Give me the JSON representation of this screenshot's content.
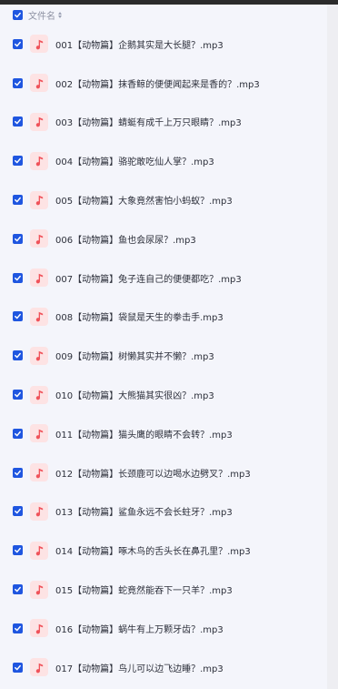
{
  "header": {
    "column_label": "文件名",
    "checked": true
  },
  "colors": {
    "checkbox": "#1f56e0",
    "music_icon": "#f0525a",
    "music_icon_bg": "#fde3e4"
  },
  "files": [
    {
      "name": "001【动物篇】企鹅其实是大长腿？.mp3",
      "checked": true,
      "icon": "music-note-icon"
    },
    {
      "name": "002【动物篇】抹香鲸的便便闻起来是香的？.mp3",
      "checked": true,
      "icon": "music-note-icon"
    },
    {
      "name": "003【动物篇】蜻蜓有成千上万只眼睛？.mp3",
      "checked": true,
      "icon": "music-note-icon"
    },
    {
      "name": "004【动物篇】骆驼敢吃仙人掌？.mp3",
      "checked": true,
      "icon": "music-note-icon"
    },
    {
      "name": "005【动物篇】大象竟然害怕小蚂蚁？.mp3",
      "checked": true,
      "icon": "music-note-icon"
    },
    {
      "name": "006【动物篇】鱼也会尿尿？.mp3",
      "checked": true,
      "icon": "music-note-icon"
    },
    {
      "name": "007【动物篇】兔子连自己的便便都吃？.mp3",
      "checked": true,
      "icon": "music-note-icon"
    },
    {
      "name": "008【动物篇】袋鼠是天生的拳击手.mp3",
      "checked": true,
      "icon": "music-note-icon"
    },
    {
      "name": "009【动物篇】树懒其实并不懒？.mp3",
      "checked": true,
      "icon": "music-note-icon"
    },
    {
      "name": "010【动物篇】大熊猫其实很凶？.mp3",
      "checked": true,
      "icon": "music-note-icon"
    },
    {
      "name": "011【动物篇】猫头鹰的眼睛不会转？.mp3",
      "checked": true,
      "icon": "music-note-icon"
    },
    {
      "name": "012【动物篇】长颈鹿可以边喝水边劈叉？.mp3",
      "checked": true,
      "icon": "music-note-icon"
    },
    {
      "name": "013【动物篇】鲨鱼永远不会长蛀牙？.mp3",
      "checked": true,
      "icon": "music-note-icon"
    },
    {
      "name": "014【动物篇】啄木鸟的舌头长在鼻孔里？.mp3",
      "checked": true,
      "icon": "music-note-icon"
    },
    {
      "name": "015【动物篇】蛇竟然能吞下一只羊？.mp3",
      "checked": true,
      "icon": "music-note-icon"
    },
    {
      "name": "016【动物篇】蜗牛有上万颗牙齿？.mp3",
      "checked": true,
      "icon": "music-note-icon"
    },
    {
      "name": "017【动物篇】鸟儿可以边飞边睡？.mp3",
      "checked": true,
      "icon": "music-note-icon"
    }
  ]
}
